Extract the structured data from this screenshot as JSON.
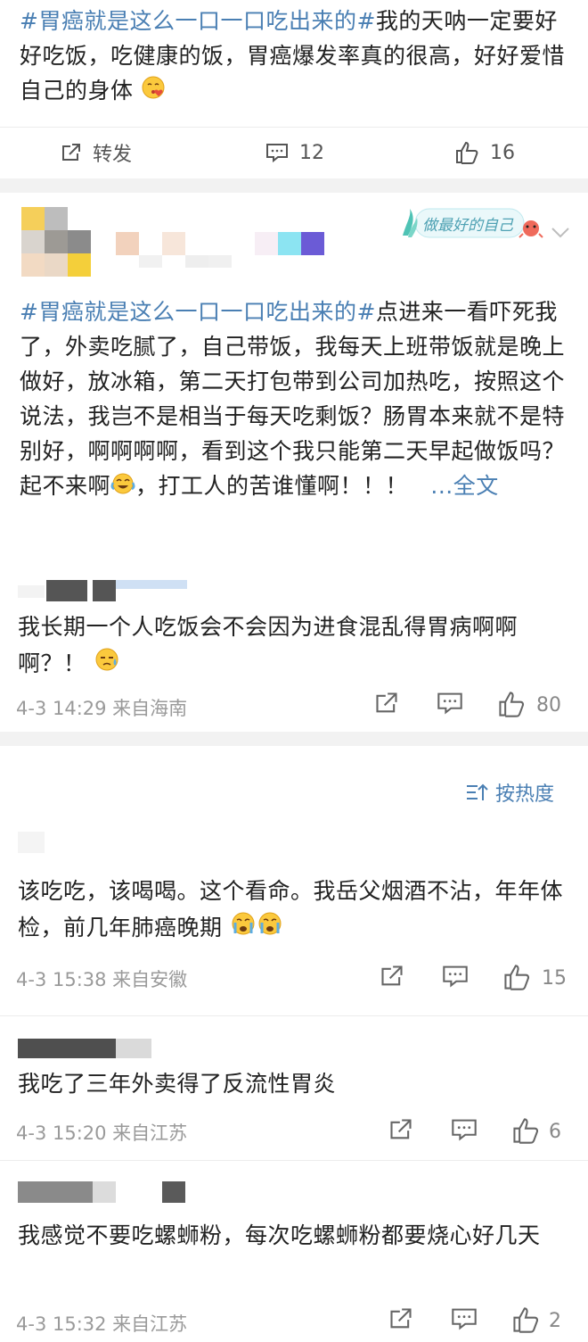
{
  "post": {
    "hashtag": "#胃癌就是这么一口一口吃出来的#",
    "text": "我的天呐一定要好好吃饭，吃健康的饭，胃癌爆发率真的很高，好好爱惜自己的身体",
    "emoji": "kiss-heart-emoji",
    "repost_label": "转发",
    "comment_count": "12",
    "like_count": "16"
  },
  "post2": {
    "badge_text": "做最好的自己",
    "hashtag": "#胃癌就是这么一口一口吃出来的#",
    "text": "点进来一看吓死我了，外卖吃腻了，自己带饭，我每天上班带饭就是晚上做好，放冰箱，第二天打包带到公司加热吃，按照这个说法，我岂不是相当于每天吃剩饭？肠胃本来就不是特别好，啊啊啊啊，看到这个我只能第二天早起做饭吗？起不来啊",
    "text_tail": "，打工人的苦谁懂啊！！！",
    "ellipsis": "...",
    "more_label": "全文"
  },
  "comment_a": {
    "text": "我长期一个人吃饭会不会因为进食混乱得胃病啊啊啊？！",
    "meta": "4-3 14:29  来自海南",
    "likes": "80"
  },
  "sort_label": "按热度",
  "comments": [
    {
      "text": "该吃吃，该喝喝。这个看命。我岳父烟酒不沾，年年体检，前几年肺癌晚期",
      "meta": "4-3 15:38  来自安徽",
      "likes": "15"
    },
    {
      "text": "我吃了三年外卖得了反流性胃炎",
      "meta": "4-3 15:20  来自江苏",
      "likes": "6"
    },
    {
      "text": "我感觉不要吃螺蛳粉，每次吃螺蛳粉都要烧心好几天",
      "meta": "4-3 15:32  来自江苏",
      "likes": "2"
    }
  ],
  "colors": {
    "link": "#4a7fb3",
    "meta": "#9a9a9a",
    "separator": "#f2f2f2"
  }
}
